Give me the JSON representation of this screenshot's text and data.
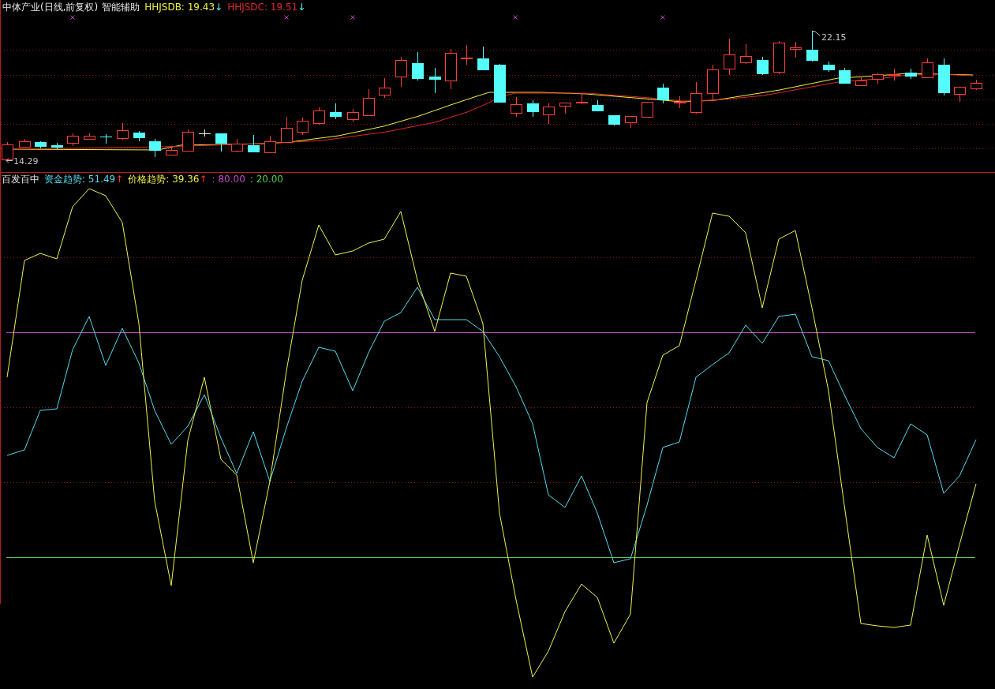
{
  "header": {
    "title": "中体产业(日线,前复权)",
    "indicator": "智能辅助",
    "legend": [
      {
        "text": "HHJSDB: 19.43",
        "color": "#f0f040",
        "arrow": "↓",
        "rising": false
      },
      {
        "text": "HHJSDC: 19.51",
        "color": "#e02828",
        "arrow": "↓",
        "rising": false
      }
    ]
  },
  "price_chart": {
    "low_label": "14.29",
    "high_label": "22.15"
  },
  "indicator_panel": {
    "name": "百发百中",
    "legend": [
      {
        "text": "资金趋势: 51.49",
        "color": "#54dcf0",
        "arrow": "↑",
        "rising": true
      },
      {
        "text": "价格趋势: 39.36",
        "color": "#f0f050",
        "arrow": "↑",
        "rising": true
      },
      {
        "text": ": 80.00",
        "color": "#c84cc8"
      },
      {
        "text": ": 20.00",
        "color": "#50d050"
      }
    ]
  }
}
